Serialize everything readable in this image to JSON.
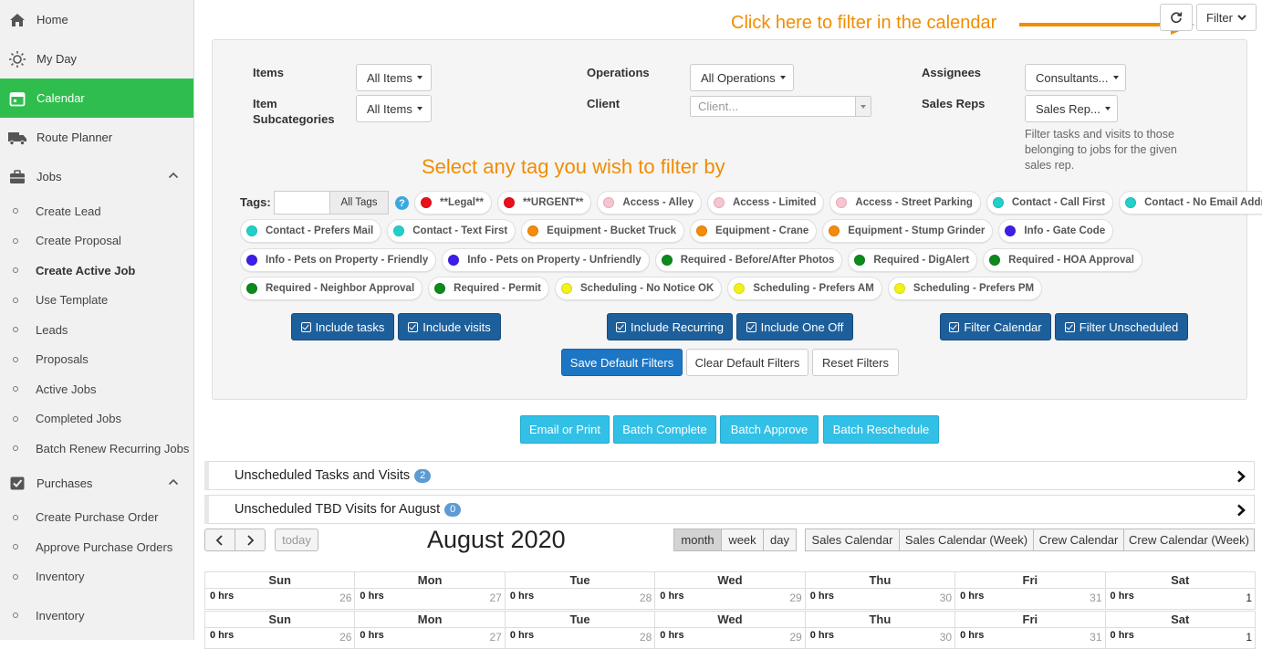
{
  "sidebar": {
    "items": [
      {
        "label": "Home",
        "icon": "home-icon"
      },
      {
        "label": "My Day",
        "icon": "sun-icon"
      },
      {
        "label": "Calendar",
        "icon": "calendar-icon",
        "active": true
      },
      {
        "label": "Route Planner",
        "icon": "truck-icon"
      },
      {
        "label": "Jobs",
        "icon": "briefcase-icon"
      }
    ],
    "jobs_sub": [
      "Create Lead",
      "Create Proposal",
      "Create Active Job",
      "Use Template",
      "Leads",
      "Proposals",
      "Active Jobs",
      "Completed Jobs",
      "Batch Renew Recurring Jobs"
    ],
    "purchases_label": "Purchases",
    "purchases_sub": [
      "Create Purchase Order",
      "Approve Purchase Orders",
      "Inventory"
    ],
    "inventory_label": "Inventory"
  },
  "header": {
    "filter_label": "Filter",
    "callout": "Click here to filter in the calendar"
  },
  "filters": {
    "items_label": "Items",
    "items_value": "All Items",
    "subcat_label": "Item Subcategories",
    "subcat_value": "All Items",
    "operations_label": "Operations",
    "operations_value": "All Operations",
    "client_label": "Client",
    "client_placeholder": "Client...",
    "assignees_label": "Assignees",
    "assignees_value": "Consultants...",
    "salesreps_label": "Sales Reps",
    "salesreps_value": "Sales Rep...",
    "salesreps_help": "Filter tasks and visits to those belonging to jobs for the given sales rep.",
    "tag_callout": "Select any tag you wish to filter by",
    "tags_label": "Tags:",
    "all_tags": "All Tags"
  },
  "tags": [
    [
      {
        "label": "**Legal**",
        "color": "#e8101a"
      },
      {
        "label": "**URGENT**",
        "color": "#e8101a"
      },
      {
        "label": "Access - Alley",
        "color": "#f7c4d0"
      },
      {
        "label": "Access - Limited",
        "color": "#f7c4d0"
      },
      {
        "label": "Access - Street Parking",
        "color": "#f7c4d0"
      },
      {
        "label": "Contact - Call First",
        "color": "#21d1c9"
      },
      {
        "label": "Contact - No Email Address",
        "color": "#21d1c9"
      }
    ],
    [
      {
        "label": "Contact - Prefers Mail",
        "color": "#21d1c9"
      },
      {
        "label": "Contact - Text First",
        "color": "#21d1c9"
      },
      {
        "label": "Equipment - Bucket Truck",
        "color": "#f58a0b"
      },
      {
        "label": "Equipment - Crane",
        "color": "#f58a0b"
      },
      {
        "label": "Equipment - Stump Grinder",
        "color": "#f58a0b"
      },
      {
        "label": "Info - Gate Code",
        "color": "#3b1ee8"
      }
    ],
    [
      {
        "label": "Info - Pets on Property - Friendly",
        "color": "#3b1ee8"
      },
      {
        "label": "Info - Pets on Property - Unfriendly",
        "color": "#3b1ee8"
      },
      {
        "label": "Required - Before/After Photos",
        "color": "#0d8a1c"
      },
      {
        "label": "Required - DigAlert",
        "color": "#0d8a1c"
      },
      {
        "label": "Required - HOA Approval",
        "color": "#0d8a1c"
      }
    ],
    [
      {
        "label": "Required - Neighbor Approval",
        "color": "#0d8a1c"
      },
      {
        "label": "Required - Permit",
        "color": "#0d8a1c"
      },
      {
        "label": "Scheduling - No Notice OK",
        "color": "#f2f21a"
      },
      {
        "label": "Scheduling - Prefers AM",
        "color": "#f2f21a"
      },
      {
        "label": "Scheduling - Prefers PM",
        "color": "#f2f21a"
      }
    ]
  ],
  "toggles": {
    "include_tasks": "Include tasks",
    "include_visits": "Include visits",
    "include_recurring": "Include Recurring",
    "include_one_off": "Include One Off",
    "filter_calendar": "Filter Calendar",
    "filter_unscheduled": "Filter Unscheduled"
  },
  "actions": {
    "save_default": "Save Default Filters",
    "clear_default": "Clear Default Filters",
    "reset": "Reset Filters",
    "email_print": "Email or Print",
    "batch_complete": "Batch Complete",
    "batch_approve": "Batch Approve",
    "batch_reschedule": "Batch Reschedule"
  },
  "unscheduled": {
    "tasks_label": "Unscheduled Tasks and Visits",
    "tasks_count": "2",
    "tbd_label": "Unscheduled TBD Visits for August",
    "tbd_count": "0"
  },
  "calendar": {
    "today_label": "today",
    "title": "August 2020",
    "views": [
      "month",
      "week",
      "day"
    ],
    "active_view": "month",
    "calendars": [
      "Sales Calendar",
      "Sales Calendar (Week)",
      "Crew Calendar",
      "Crew Calendar (Week)"
    ],
    "days": [
      "Sun",
      "Mon",
      "Tue",
      "Wed",
      "Thu",
      "Fri",
      "Sat"
    ],
    "weeks": [
      {
        "hrs": [
          "0 hrs",
          "0 hrs",
          "0 hrs",
          "0 hrs",
          "0 hrs",
          "0 hrs",
          "0 hrs"
        ],
        "nums": [
          "26",
          "27",
          "28",
          "29",
          "30",
          "31",
          "1"
        ]
      },
      {
        "hrs": [
          "0 hrs",
          "0 hrs",
          "0 hrs",
          "0 hrs",
          "0 hrs",
          "0 hrs",
          "0 hrs"
        ],
        "nums": [
          "26",
          "27",
          "28",
          "29",
          "30",
          "31",
          "1"
        ]
      }
    ]
  }
}
